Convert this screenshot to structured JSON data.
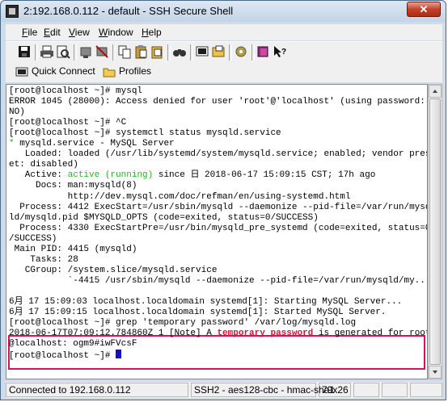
{
  "window": {
    "title": "2:192.168.0.112 - default - SSH Secure Shell",
    "close_label": "✕"
  },
  "menu": [
    "File",
    "Edit",
    "View",
    "Window",
    "Help"
  ],
  "toolbar": {
    "icons": [
      "save-icon",
      "print-icon",
      "print-preview-icon",
      "connect-icon",
      "disconnect-icon",
      "copy-icon",
      "paste-icon",
      "paste-special-icon",
      "find-icon",
      "new-terminal-icon",
      "new-file-transfer-icon",
      "settings-icon",
      "help-book-icon",
      "whats-this-icon"
    ]
  },
  "toolbar2": {
    "quick_connect": "Quick Connect",
    "profiles": "Profiles"
  },
  "terminal": {
    "lines": [
      "[root@localhost ~]# mysql",
      "ERROR 1045 (28000): Access denied for user 'root'@'localhost' (using password:",
      "NO)",
      "[root@localhost ~]# ^C",
      "[root@localhost ~]# systemctl status mysqld.service",
      "* mysqld.service - MySQL Server",
      "   Loaded: loaded (/usr/lib/systemd/system/mysqld.service; enabled; vendor pres",
      "et: disabled)",
      "   Active: active (running) since 日 2018-06-17 15:09:15 CST; 17h ago",
      "     Docs: man:mysqld(8)",
      "           http://dev.mysql.com/doc/refman/en/using-systemd.html",
      "  Process: 4412 ExecStart=/usr/sbin/mysqld --daemonize --pid-file=/var/run/mysq",
      "ld/mysqld.pid $MYSQLD_OPTS (code=exited, status=0/SUCCESS)",
      "  Process: 4330 ExecStartPre=/usr/bin/mysqld_pre_systemd (code=exited, status=0",
      "/SUCCESS)",
      " Main PID: 4415 (mysqld)",
      "    Tasks: 28",
      "   CGroup: /system.slice/mysqld.service",
      "           `-4415 /usr/sbin/mysqld --daemonize --pid-file=/var/run/mysqld/my...",
      "",
      "6月 17 15:09:03 localhost.localdomain systemd[1]: Starting MySQL Server...",
      "6月 17 15:09:15 localhost.localdomain systemd[1]: Started MySQL Server.",
      "[root@localhost ~]# grep 'temporary password' /var/log/mysqld.log",
      "2018-06-17T07:09:12.784860Z 1 [Note] A temporary password is generated for root",
      "@localhost: ogm9#iwFVcsF",
      "[root@localhost ~]# "
    ],
    "active_word": "active (running)",
    "bullet": "*",
    "highlight_word": "temporary password"
  },
  "status": {
    "connection": "Connected to 192.168.0.112",
    "cipher": "SSH2 - aes128-cbc - hmac-sha1",
    "size": "79x26"
  },
  "colors": {
    "highlight_box": "#d4145a",
    "active": "#1fbe1f",
    "temp_password": "#e0103a",
    "cursor": "#1010d0"
  }
}
